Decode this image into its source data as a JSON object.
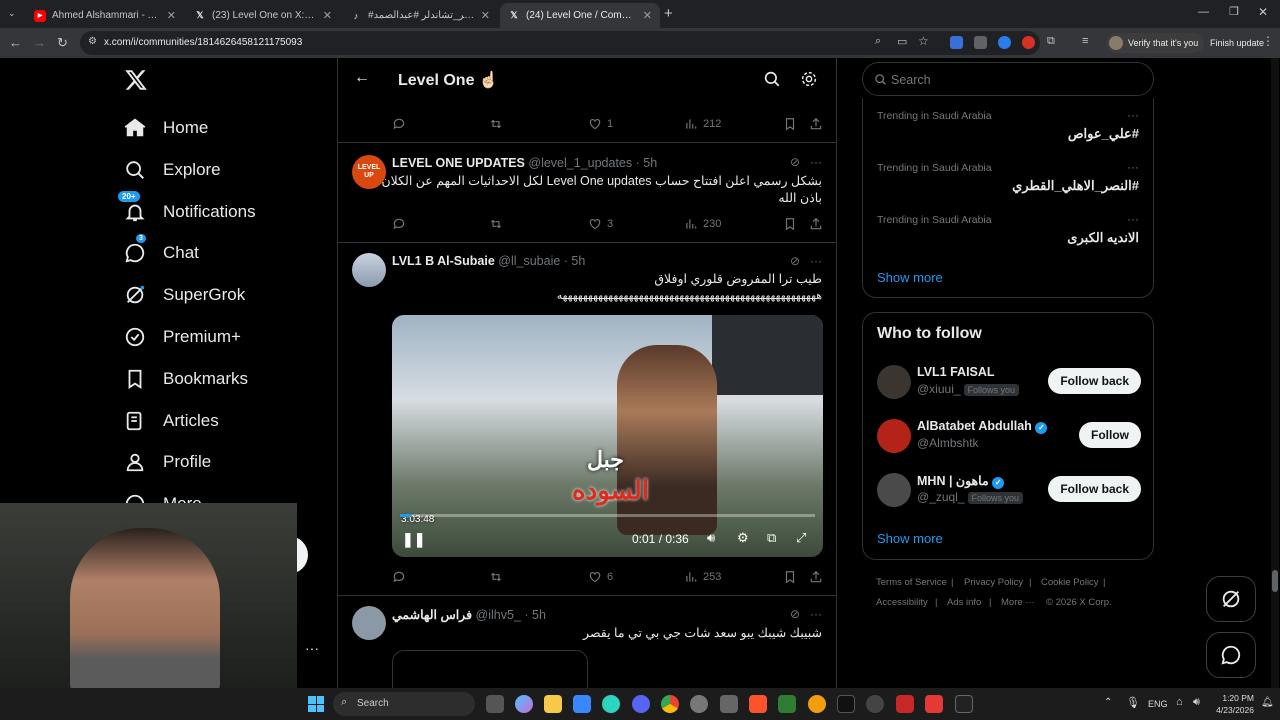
{
  "browser": {
    "tabs": [
      {
        "title": "Ahmed Alshammari - YouTube",
        "icon": "youtube-icon",
        "active": false
      },
      {
        "title": "(23) Level One on X: \"الهدف أكبر",
        "icon": "x-logo-icon",
        "active": false
      },
      {
        "title": "#مجه #كيلر_تشاندلر #عبدالصمد",
        "icon": "tiktok-icon",
        "active": false
      },
      {
        "title": "(24) Level One / Communi",
        "icon": "x-logo-icon",
        "active": true
      }
    ],
    "url": "x.com/i/communities/1814626458121175093",
    "profile_label": "Verify that it's you",
    "finish_update_label": "Finish update"
  },
  "nav": {
    "items": [
      {
        "label": "Home",
        "icon": "home-icon"
      },
      {
        "label": "Explore",
        "icon": "search-icon"
      },
      {
        "label": "Notifications",
        "icon": "bell-icon",
        "badge": "20+"
      },
      {
        "label": "Chat",
        "icon": "chat-icon",
        "badge": "3"
      },
      {
        "label": "SuperGrok",
        "icon": "grok-icon"
      },
      {
        "label": "Premium+",
        "icon": "premium-icon"
      },
      {
        "label": "Bookmarks",
        "icon": "bookmark-icon"
      },
      {
        "label": "Articles",
        "icon": "articles-icon"
      },
      {
        "label": "Profile",
        "icon": "profile-icon"
      },
      {
        "label": "More",
        "icon": "more-icon"
      }
    ]
  },
  "header": {
    "title": "Level One ☝🏻"
  },
  "posts": [
    {
      "partial_text": "...",
      "replies": "",
      "reposts": "",
      "likes": "1",
      "views": "212"
    },
    {
      "name": "LEVEL ONE UPDATES",
      "handle": "@level_1_updates",
      "time": "5h",
      "text_line1": "بشكل رسمي اعلن افتتاح حساب Level One updates لكل الاحداثيات المهم عن الكلان",
      "text_line2": "باذن الله",
      "likes": "3",
      "views": "230",
      "avatar_text": "LEVEL UP"
    },
    {
      "name": "LVL1 B Al-Subaie",
      "handle": "@ll_subaie",
      "time": "5h",
      "text_line1": "طيب ترا المفروض قلوري اوفلاق",
      "text_line2": "هههههههههههههههههههههههههههههههههههههههههههههههههههه",
      "video": {
        "corner_time": "3:03:48",
        "position": "0:01",
        "duration": "0:36",
        "overlay_text_1": "جبل",
        "overlay_text_2": "السوده",
        "progress": 0.03
      },
      "likes": "6",
      "views": "253"
    },
    {
      "name": "فراس الهاشمي",
      "handle": "@ilhv5_",
      "time": "5h",
      "text_line1": "شبيبك شيبك يبو سعد شات جي بي تي ما يقصر"
    }
  ],
  "search": {
    "placeholder": "Search"
  },
  "trends": [
    {
      "meta": "Trending in Saudi Arabia",
      "name": "#علي_عواص"
    },
    {
      "meta": "Trending in Saudi Arabia",
      "name": "#النصر_الاهلي_القطري"
    },
    {
      "meta": "Trending in Saudi Arabia",
      "name": "الانديه الكبرى"
    }
  ],
  "show_more": "Show more",
  "who_to_follow": {
    "title": "Who to follow",
    "items": [
      {
        "name": "LVL1 FAISAL",
        "handle": "@xiuui_",
        "follows_you": "Follows you",
        "button": "Follow back",
        "verified": false
      },
      {
        "name": "AlBatabet Abdullah",
        "handle": "@Almbshtk",
        "follows_you": "",
        "button": "Follow",
        "verified": true
      },
      {
        "name": "MHN | ماهون",
        "handle": "@_zuql_",
        "follows_you": "Follows you",
        "button": "Follow back",
        "verified": true
      }
    ]
  },
  "footer": {
    "links": [
      "Terms of Service",
      "Privacy Policy",
      "Cookie Policy",
      "Accessibility",
      "Ads info",
      "More ···"
    ],
    "copyright": "© 2026 X Corp."
  },
  "taskbar": {
    "search_placeholder": "Search",
    "language": "ENG",
    "time": "1:20 PM",
    "date": "4/23/2026"
  },
  "colors": {
    "accent": "#1d9bf0",
    "background": "#000000",
    "border": "#2f3336",
    "muted": "#71767b"
  }
}
